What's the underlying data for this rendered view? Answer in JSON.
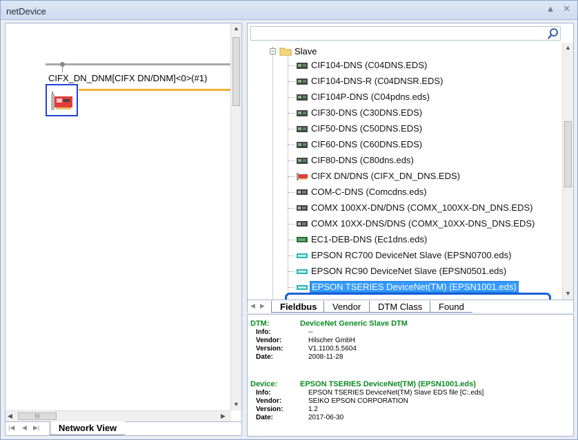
{
  "window": {
    "title": "netDevice",
    "pin_glyph": "▲",
    "close_glyph": "✕"
  },
  "network_view": {
    "device_label": "CIFX_DN_DNM[CIFX DN/DNM]<0>(#1)",
    "tab_label": "Network View",
    "scroll_grip": "III"
  },
  "catalog": {
    "search": {
      "value": "",
      "placeholder": ""
    },
    "root": {
      "expander": "−",
      "label": "Slave"
    },
    "items": [
      {
        "label": "CIF104-DNS (C04DNS.EDS)",
        "icon": "card-icon"
      },
      {
        "label": "CIF104-DNS-R (C04DNSR.EDS)",
        "icon": "card-icon"
      },
      {
        "label": "CIF104P-DNS (C04pdns.eds)",
        "icon": "card-icon"
      },
      {
        "label": "CIF30-DNS (C30DNS.EDS)",
        "icon": "card-icon"
      },
      {
        "label": "CIF50-DNS (C50DNS.EDS)",
        "icon": "card-icon"
      },
      {
        "label": "CIF60-DNS (C60DNS.EDS)",
        "icon": "card-icon"
      },
      {
        "label": "CIF80-DNS (C80dns.eds)",
        "icon": "card-icon"
      },
      {
        "label": "CIFX DN/DNS (CIFX_DN_DNS.EDS)",
        "icon": "pci-card-icon"
      },
      {
        "label": "COM-C-DNS (Comcdns.eds)",
        "icon": "module-icon"
      },
      {
        "label": "COMX 100XX-DN/DNS (COMX_100XX-DN_DNS.EDS)",
        "icon": "module-icon"
      },
      {
        "label": "COMX 10XX-DNS/DNS (COMX_10XX-DNS_DNS.EDS)",
        "icon": "module-icon"
      },
      {
        "label": "EC1-DEB-DNS (Ec1dns.eds)",
        "icon": "green-module-icon"
      },
      {
        "label": "EPSON RC700 DeviceNet Slave (EPSN0700.eds)",
        "icon": "teal-device-icon"
      },
      {
        "label": "EPSON RC90 DeviceNet Slave (EPSN0501.eds)",
        "icon": "teal-device-icon"
      },
      {
        "label": "EPSON TSERIES DeviceNet(TM) (EPSN1001.eds)",
        "icon": "teal-device-icon",
        "selected": true
      }
    ],
    "tabs": [
      "Fieldbus",
      "Vendor",
      "DTM Class",
      "Found"
    ],
    "active_tab": "Fieldbus"
  },
  "info": {
    "dtm": {
      "heading_key": "DTM:",
      "heading_value": "DeviceNet Generic Slave DTM",
      "rows": [
        {
          "key": "Info:",
          "value": "--"
        },
        {
          "key": "Vendor:",
          "value": "Hilscher GmbH"
        },
        {
          "key": "Version:",
          "value": "V1.1100.5.5604"
        },
        {
          "key": "Date:",
          "value": "2008-11-28"
        }
      ]
    },
    "device": {
      "heading_key": "Device:",
      "heading_value": "EPSON TSERIES DeviceNet(TM) (EPSN1001.eds)",
      "rows": [
        {
          "key": "Info:",
          "value": "EPSON TSERIES DeviceNet(TM) Slave EDS file [C:.eds]"
        },
        {
          "key": "Vendor:",
          "value": "SEIKO EPSON CORPORATION"
        },
        {
          "key": "Version:",
          "value": "1.2"
        },
        {
          "key": "Date:",
          "value": "2017-06-30"
        }
      ]
    }
  },
  "colors": {
    "accent": "#1560d8",
    "selection": "#3399ff",
    "bus_active": "#f0b030",
    "info_heading": "#0b8a22"
  }
}
